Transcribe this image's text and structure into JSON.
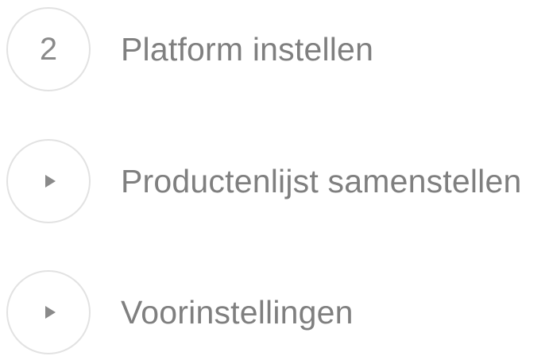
{
  "steps": [
    {
      "indicator": "2",
      "indicator_type": "number",
      "label": "Platform instellen"
    },
    {
      "indicator": "",
      "indicator_type": "play-icon",
      "label": "Productenlijst samenstellen"
    },
    {
      "indicator": "",
      "indicator_type": "play-icon",
      "label": "Voorinstellingen"
    }
  ],
  "colors": {
    "circle_border": "#e2e2e2",
    "text": "#7f7f7f",
    "icon": "#8a8a8a",
    "background": "#ffffff"
  }
}
